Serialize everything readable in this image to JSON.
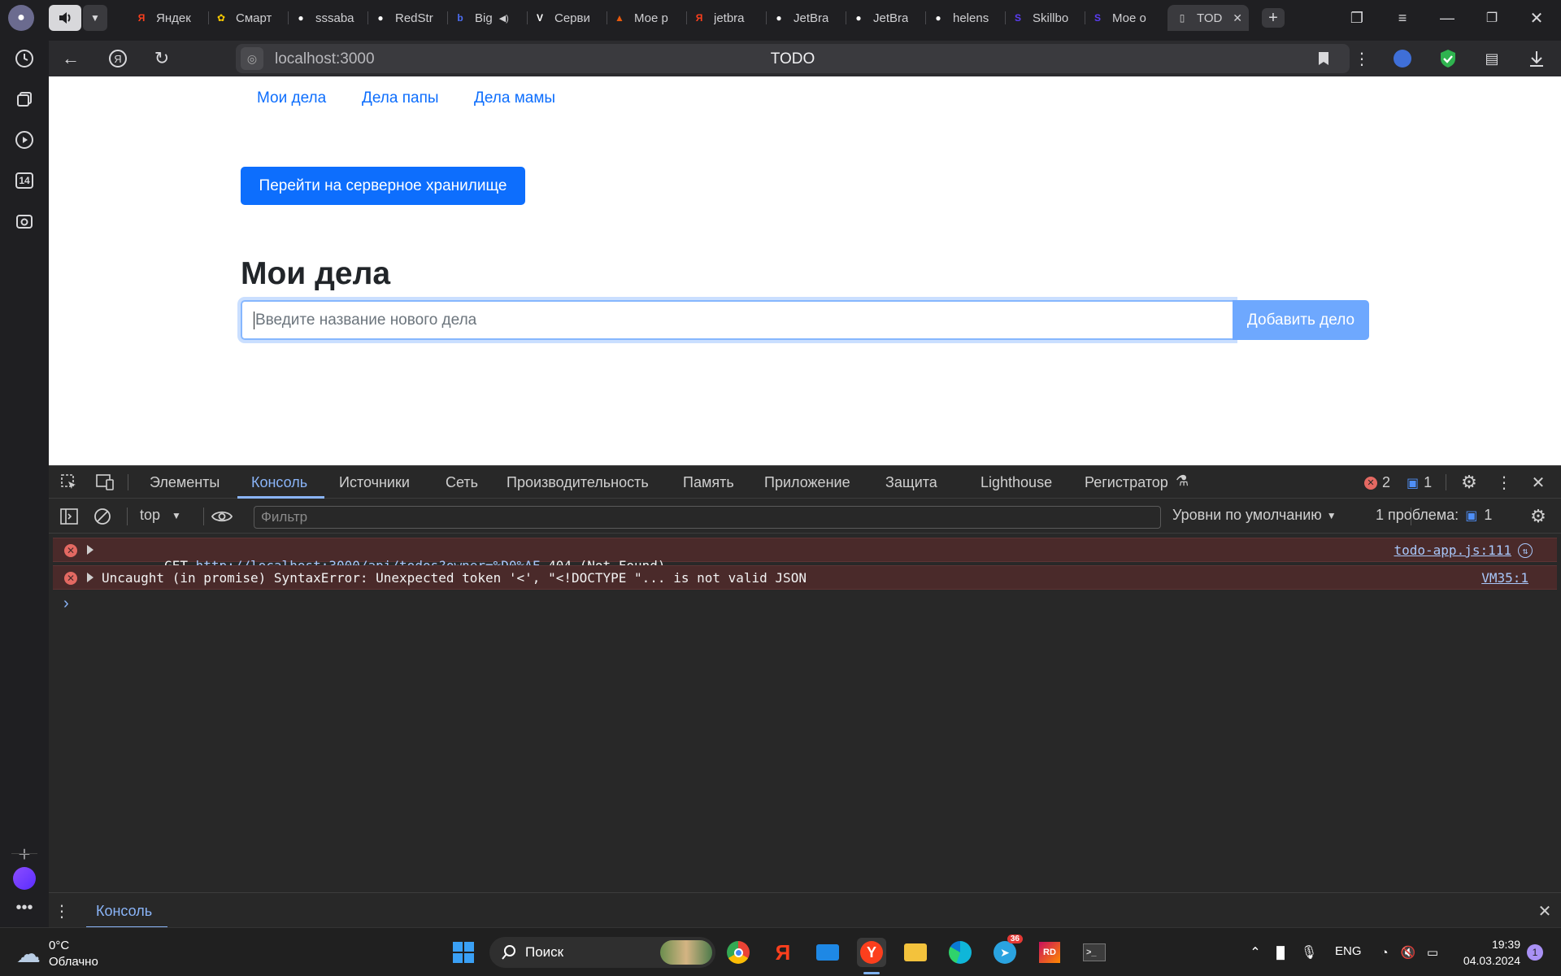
{
  "browser": {
    "tabs": [
      {
        "label": "Яндек",
        "icon": "yandex-icon",
        "color": "#fc3f1d",
        "fav": "Я"
      },
      {
        "label": "Смарт",
        "icon": "smart-icon",
        "color": "#ffcc00",
        "fav": "✿"
      },
      {
        "label": "sssaba",
        "icon": "github-icon",
        "color": "#ffffff",
        "fav": "●"
      },
      {
        "label": "RedStr",
        "icon": "github-icon",
        "color": "#ffffff",
        "fav": "●"
      },
      {
        "label": "Big",
        "icon": "b-icon",
        "color": "#4c6ef5",
        "fav": "b"
      },
      {
        "label": "Серви",
        "icon": "service-icon",
        "color": "#ffffff",
        "fav": "V"
      },
      {
        "label": "Мое р",
        "icon": "cap-icon",
        "color": "#e8590c",
        "fav": "▲"
      },
      {
        "label": "jetbra",
        "icon": "yandex-icon",
        "color": "#fc3f1d",
        "fav": "Я"
      },
      {
        "label": "JetBra",
        "icon": "github-icon",
        "color": "#ffffff",
        "fav": "●"
      },
      {
        "label": "JetBra",
        "icon": "github-icon",
        "color": "#ffffff",
        "fav": "●"
      },
      {
        "label": "helens",
        "icon": "github-icon",
        "color": "#ffffff",
        "fav": "●"
      },
      {
        "label": "Skillbo",
        "icon": "skillbox-icon",
        "color": "#5b3df5",
        "fav": "S"
      },
      {
        "label": "Мое о",
        "icon": "skillbox-icon",
        "color": "#5b3df5",
        "fav": "S"
      },
      {
        "label": "TOD",
        "icon": "page-icon",
        "color": "#cccccc",
        "fav": "▯"
      }
    ],
    "url": "localhost:3000",
    "page_title": "TODO"
  },
  "page": {
    "nav": [
      "Мои дела",
      "Дела папы",
      "Дела мамы"
    ],
    "server_button": "Перейти на серверное хранилище",
    "title": "Мои дела",
    "input_placeholder": "Введите название нового дела",
    "add_button": "Добавить дело"
  },
  "devtools": {
    "tabs": [
      "Элементы",
      "Консоль",
      "Источники",
      "Сеть",
      "Производительность",
      "Память",
      "Приложение",
      "Защита",
      "Lighthouse",
      "Регистратор"
    ],
    "error_count": "2",
    "message_count": "1",
    "context": "top",
    "filter_placeholder": "Фильтр",
    "levels": "Уровни по умолчанию",
    "issues_label": "1 проблема:",
    "issues_count": "1",
    "messages": [
      {
        "prefix": "GET ",
        "link": "http://localhost:3000/api/todos?owner=%D0%AF",
        "suffix": " 404 (Not Found)",
        "source": "todo-app.js:111"
      },
      {
        "prefix": "Uncaught (in promise) SyntaxError: Unexpected token '<', \"<!DOCTYPE \"... is not valid JSON",
        "link": "",
        "suffix": "",
        "source": "VM35:1"
      }
    ],
    "prompt": "›",
    "drawer_tab": "Консоль"
  },
  "taskbar": {
    "weather_temp": "0°C",
    "weather_desc": "Облачно",
    "search_label": "Поиск",
    "language": "ENG",
    "time": "19:39",
    "date": "04.03.2024",
    "telegram_badge": "36",
    "notification_badge": "1",
    "sidebar_badge": "14"
  },
  "colors": {
    "accent": "#0d6efd",
    "error_bg": "#4a2a2a",
    "devtools_link": "#a8c7fa"
  }
}
